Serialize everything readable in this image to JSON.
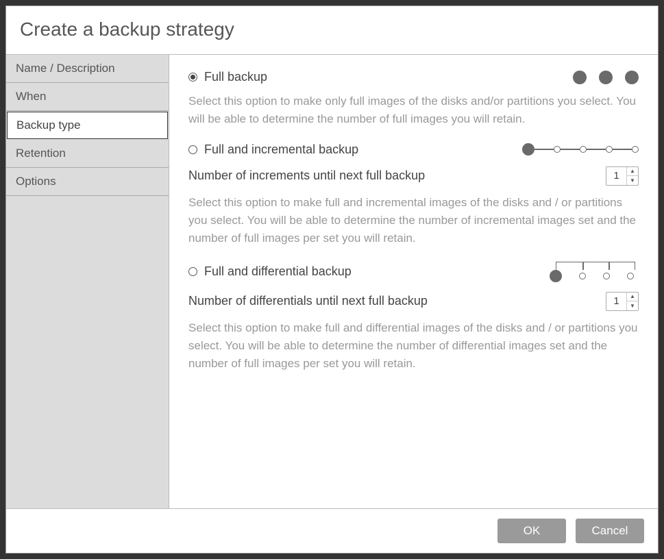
{
  "dialog": {
    "title": "Create a backup strategy"
  },
  "sidebar": {
    "items": [
      {
        "label": "Name / Description",
        "active": false
      },
      {
        "label": "When",
        "active": false
      },
      {
        "label": "Backup type",
        "active": true
      },
      {
        "label": "Retention",
        "active": false
      },
      {
        "label": "Options",
        "active": false
      }
    ]
  },
  "content": {
    "full": {
      "label": "Full backup",
      "selected": true,
      "desc": "Select this option to make only full images of the disks and/or partitions you select. You will be able to determine the number of full images you will retain."
    },
    "incremental": {
      "label": "Full and incremental backup",
      "selected": false,
      "spinner_label": "Number of increments until next full backup",
      "spinner_value": "1",
      "desc": "Select this option to make full and incremental images of the disks and / or partitions you select. You will be able to determine the number of incremental images set and the number of full images per set you will retain."
    },
    "differential": {
      "label": "Full and differential backup",
      "selected": false,
      "spinner_label": "Number of differentials until next full backup",
      "spinner_value": "1",
      "desc": "Select this option to make full and differential images of the disks and / or partitions you select. You will be able to determine the number of differential images set and the number of full images per set you will retain."
    }
  },
  "footer": {
    "ok": "OK",
    "cancel": "Cancel"
  }
}
